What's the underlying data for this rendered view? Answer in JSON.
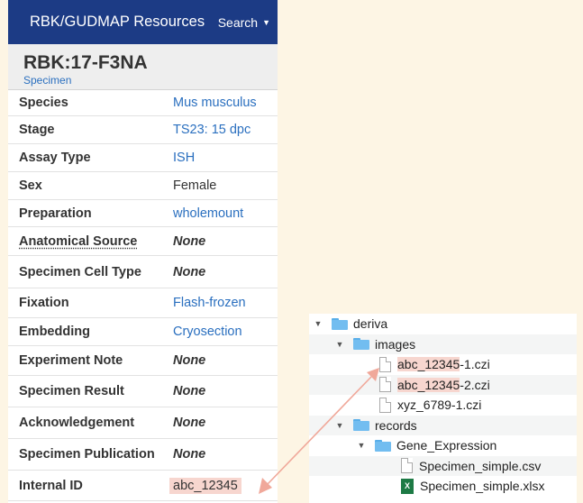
{
  "navbar": {
    "brand": "RBK/GUDMAP Resources",
    "search_label": "Search"
  },
  "record": {
    "title": "RBK:17-F3NA",
    "subtitle": "Specimen"
  },
  "fields": [
    {
      "label": "Species",
      "value": "Mus musculus"
    },
    {
      "label": "Stage",
      "value": "TS23: 15 dpc"
    },
    {
      "label": "Assay Type",
      "value": "ISH"
    },
    {
      "label": "Sex",
      "value": "Female"
    },
    {
      "label": "Preparation",
      "value": "wholemount"
    },
    {
      "label": "Anatomical Source",
      "value": "None"
    },
    {
      "label": "Specimen Cell Type",
      "value": "None"
    },
    {
      "label": "Fixation",
      "value": "Flash-frozen"
    },
    {
      "label": "Embedding",
      "value": "Cryosection"
    },
    {
      "label": "Experiment Note",
      "value": "None"
    },
    {
      "label": "Specimen Result",
      "value": "None"
    },
    {
      "label": "Acknowledgement",
      "value": "None"
    },
    {
      "label": "Specimen Publication",
      "value": "None"
    },
    {
      "label": "Internal ID",
      "value": "abc_12345"
    }
  ],
  "tree": {
    "items": [
      {
        "name": "deriva"
      },
      {
        "name": "images"
      },
      {
        "name_hl": "abc_12345",
        "name_rest": "-1.czi"
      },
      {
        "name_hl": "abc_12345",
        "name_rest": "-2.czi"
      },
      {
        "name": "xyz_6789-1.czi"
      },
      {
        "name": "records"
      },
      {
        "name": "Gene_Expression"
      },
      {
        "name": "Specimen_simple.csv"
      },
      {
        "name": "Specimen_simple.xlsx"
      }
    ]
  },
  "colors": {
    "navbar": "#1c3b85",
    "link": "#2a6fbf",
    "highlight": "#f7d6cf",
    "arrow": "#f0a89a",
    "background": "#fdf5e4"
  }
}
